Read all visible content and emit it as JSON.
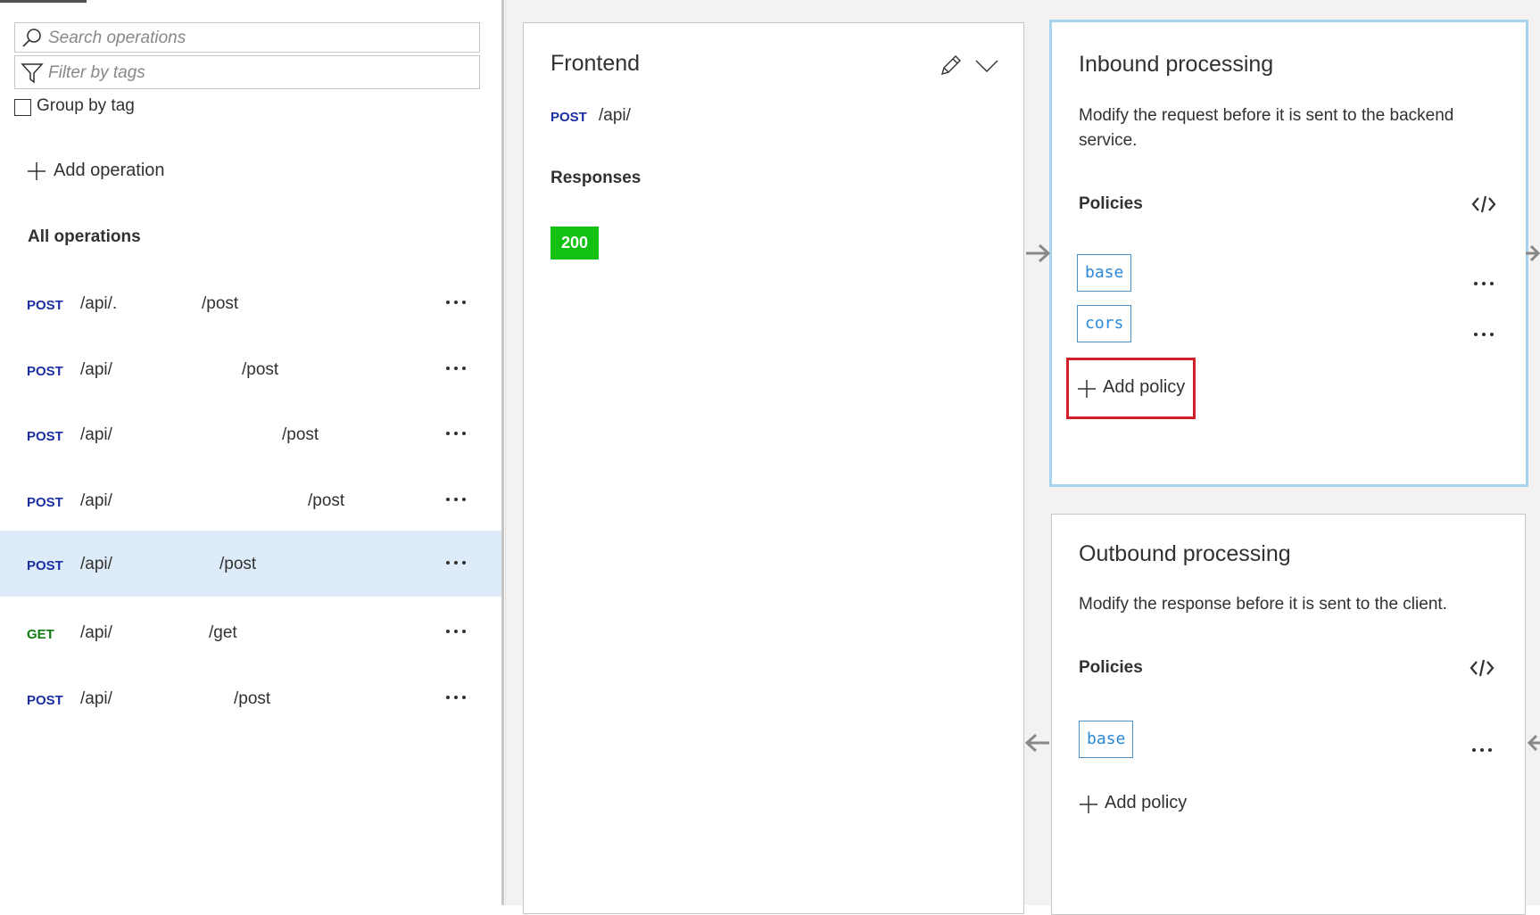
{
  "search": {
    "placeholder": "Search operations",
    "icon": "search-icon"
  },
  "filter": {
    "placeholder": "Filter by tags",
    "icon": "filter-icon"
  },
  "group_by_tag": {
    "label": "Group by tag",
    "checked": false
  },
  "add_operation": {
    "label": "Add operation"
  },
  "all_operations": {
    "label": "All operations"
  },
  "operations": [
    {
      "method": "POST",
      "path": "/api/.",
      "suffix": "/post",
      "selected": false
    },
    {
      "method": "POST",
      "path": "/api/",
      "suffix": "/post",
      "selected": false
    },
    {
      "method": "POST",
      "path": "/api/",
      "suffix": "/post",
      "selected": false
    },
    {
      "method": "POST",
      "path": "/api/",
      "suffix": "/post",
      "selected": false
    },
    {
      "method": "POST",
      "path": "/api/",
      "suffix": "/post",
      "selected": true
    },
    {
      "method": "GET",
      "path": "/api/",
      "suffix": "/get",
      "selected": false
    },
    {
      "method": "POST",
      "path": "/api/",
      "suffix": "/post",
      "selected": false
    }
  ],
  "frontend": {
    "title": "Frontend",
    "method": "POST",
    "path": "/api/",
    "responses_label": "Responses",
    "status_code": "200",
    "status_color": "#13c113"
  },
  "inbound": {
    "title": "Inbound processing",
    "description": "Modify the request before it is sent to the backend service.",
    "policies_label": "Policies",
    "policies": [
      "base",
      "cors"
    ],
    "add_policy_label": "Add policy"
  },
  "outbound": {
    "title": "Outbound processing",
    "description": "Modify the response before it is sent to the client.",
    "policies_label": "Policies",
    "policies": [
      "base"
    ],
    "add_policy_label": "Add policy"
  },
  "colors": {
    "accent": "#2b88d8",
    "selected_row": "#deecf9",
    "highlight": "#d0202a",
    "post": "#1b2fa3",
    "get": "#107c10"
  }
}
